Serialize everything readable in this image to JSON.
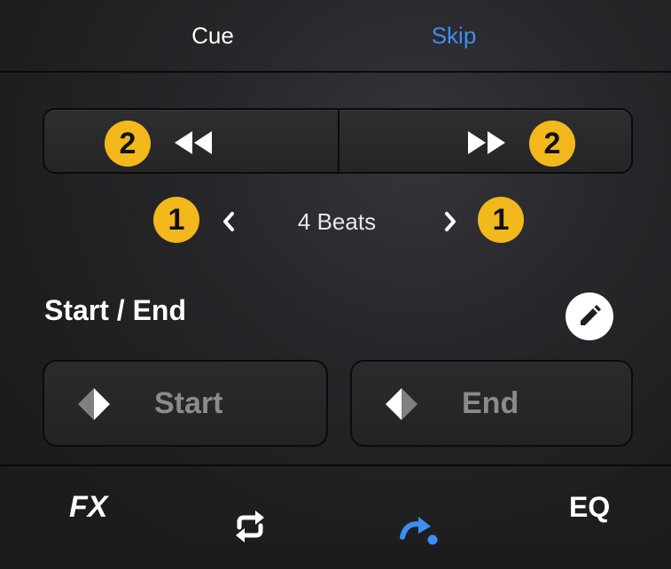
{
  "tabs": [
    {
      "label": "Cue",
      "active": false
    },
    {
      "label": "Skip",
      "active": true
    }
  ],
  "accent_color": "#3d8ef2",
  "badge_color": "#f2b81c",
  "skip": {
    "back_icon": "rewind-icon",
    "forward_icon": "fast-forward-icon",
    "back_badge": "2",
    "forward_badge": "2"
  },
  "beats": {
    "value": "4 Beats",
    "decrease_icon": "chevron-left-icon",
    "increase_icon": "chevron-right-icon",
    "decrease_badge": "1",
    "increase_badge": "1"
  },
  "start_end": {
    "title": "Start / End",
    "edit_icon": "pencil-icon",
    "start_label": "Start",
    "end_label": "End"
  },
  "bottom_nav": {
    "fx_label": "FX",
    "loop_icon": "loop-icon",
    "skip_icon": "skip-arrow-icon",
    "eq_label": "EQ"
  }
}
